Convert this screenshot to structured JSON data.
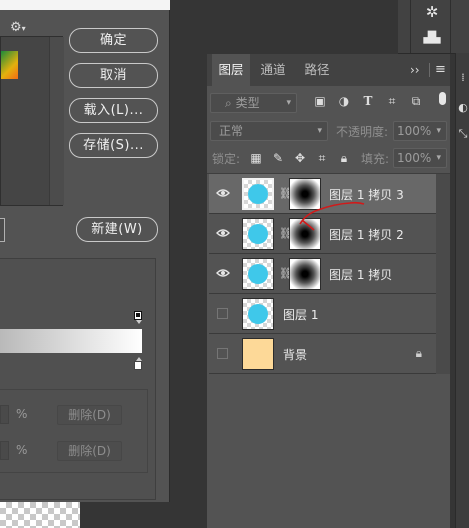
{
  "dialog": {
    "buttons": {
      "ok": "确定",
      "cancel": "取消",
      "load": "载入(L)...",
      "save": "存储(S)...",
      "new": "新建(W)"
    },
    "stops": {
      "percent_unit": "%",
      "delete_label": "删除(D)"
    }
  },
  "layers_panel": {
    "tabs": [
      "图层",
      "通道",
      "路径"
    ],
    "active_tab": "图层",
    "filter": {
      "kind_label": "类型"
    },
    "blend_mode": "正常",
    "opacity": {
      "label": "不透明度:",
      "value": "100%"
    },
    "lock": {
      "label": "锁定:"
    },
    "fill": {
      "label": "填充:",
      "value": "100%"
    },
    "layers": [
      {
        "name": "图层 1 拷贝 3",
        "visible": true,
        "selected": true,
        "has_mask": true
      },
      {
        "name": "图层 1 拷贝 2",
        "visible": true,
        "selected": false,
        "has_mask": true
      },
      {
        "name": "图层 1 拷贝",
        "visible": true,
        "selected": false,
        "has_mask": true
      },
      {
        "name": "图层 1",
        "visible": false,
        "selected": false,
        "has_mask": false
      },
      {
        "name": "背景",
        "visible": false,
        "selected": false,
        "has_mask": false,
        "locked": true
      }
    ]
  },
  "colors": {
    "layer_circle": "#3fc8ea",
    "background_fill": "#fdd998",
    "annotation_stroke": "#d11a1a"
  }
}
